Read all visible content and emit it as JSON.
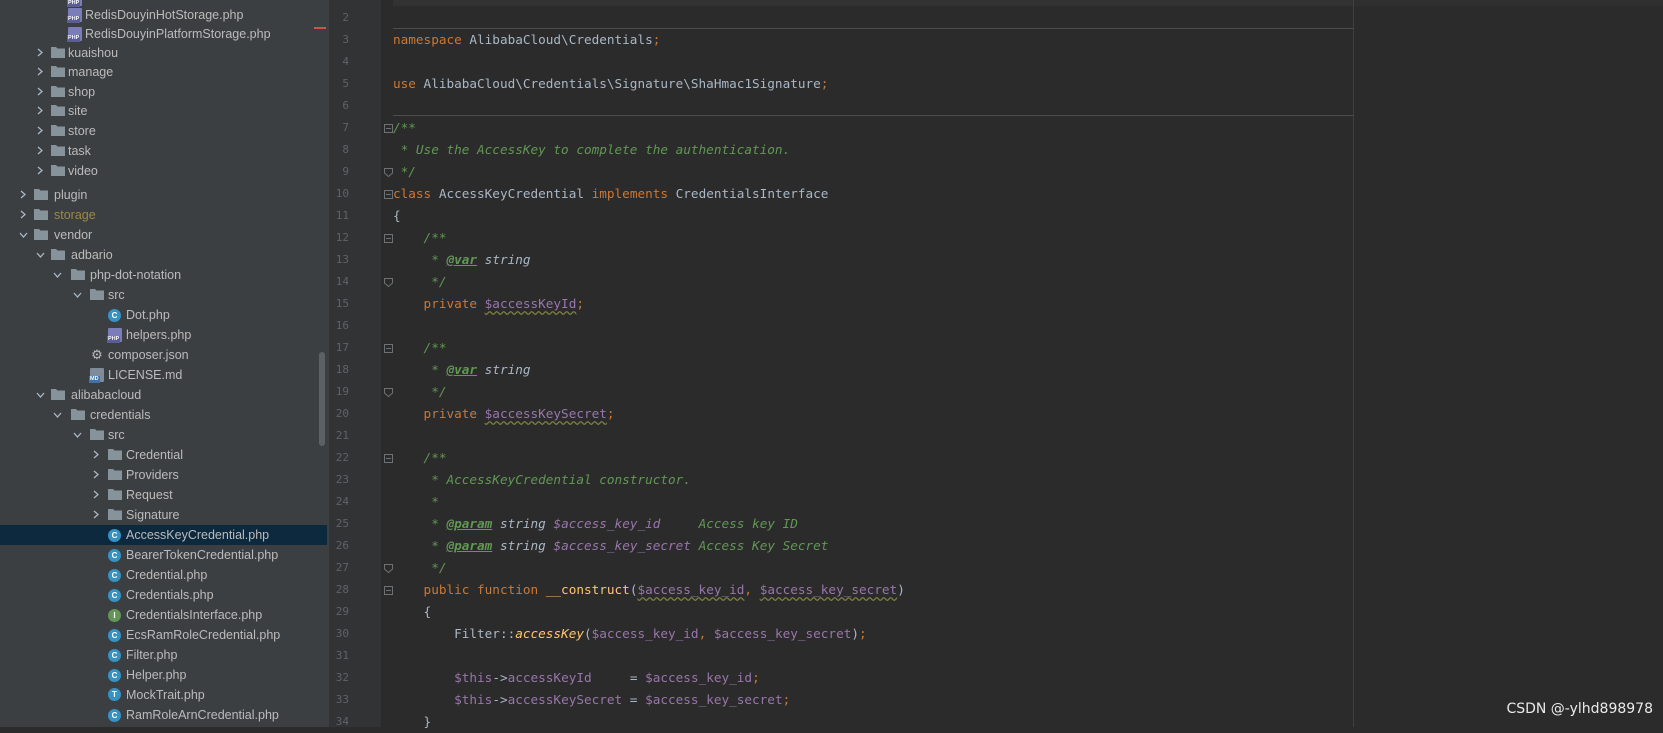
{
  "tree": [
    {
      "label": "RedisDouyinHotStorage.php",
      "icon": "php"
    },
    {
      "label": "RedisDouyinPlatformStorage.php",
      "icon": "php"
    },
    {
      "label": "kuaishou",
      "icon": "folder"
    },
    {
      "label": "manage",
      "icon": "folder"
    },
    {
      "label": "shop",
      "icon": "folder"
    },
    {
      "label": "site",
      "icon": "folder"
    },
    {
      "label": "store",
      "icon": "folder"
    },
    {
      "label": "task",
      "icon": "folder"
    },
    {
      "label": "video",
      "icon": "folder"
    },
    {
      "label": "plugin",
      "icon": "folder"
    },
    {
      "label": "storage",
      "icon": "folder"
    },
    {
      "label": "vendor",
      "icon": "folder"
    },
    {
      "label": "adbario",
      "icon": "folder"
    },
    {
      "label": "php-dot-notation",
      "icon": "folder"
    },
    {
      "label": "src",
      "icon": "folder"
    },
    {
      "label": "Dot.php",
      "icon": "class"
    },
    {
      "label": "helpers.php",
      "icon": "php"
    },
    {
      "label": "composer.json",
      "icon": "json"
    },
    {
      "label": "LICENSE.md",
      "icon": "md"
    },
    {
      "label": "alibabacloud",
      "icon": "folder"
    },
    {
      "label": "credentials",
      "icon": "folder"
    },
    {
      "label": "src",
      "icon": "folder"
    },
    {
      "label": "Credential",
      "icon": "folder"
    },
    {
      "label": "Providers",
      "icon": "folder"
    },
    {
      "label": "Request",
      "icon": "folder"
    },
    {
      "label": "Signature",
      "icon": "folder"
    },
    {
      "label": "AccessKeyCredential.php",
      "icon": "class"
    },
    {
      "label": "BearerTokenCredential.php",
      "icon": "class"
    },
    {
      "label": "Credential.php",
      "icon": "class"
    },
    {
      "label": "Credentials.php",
      "icon": "class"
    },
    {
      "label": "CredentialsInterface.php",
      "icon": "interface"
    },
    {
      "label": "EcsRamRoleCredential.php",
      "icon": "class"
    },
    {
      "label": "Filter.php",
      "icon": "class"
    },
    {
      "label": "Helper.php",
      "icon": "class"
    },
    {
      "label": "MockTrait.php",
      "icon": "trait"
    },
    {
      "label": "RamRoleArnCredential.php",
      "icon": "class"
    }
  ],
  "selected_file": "AccessKeyCredential.php",
  "line_numbers": [
    "2",
    "3",
    "4",
    "5",
    "6",
    "7",
    "8",
    "9",
    "10",
    "11",
    "12",
    "13",
    "14",
    "15",
    "16",
    "17",
    "18",
    "19",
    "20",
    "21",
    "22",
    "23",
    "24",
    "25",
    "26",
    "27",
    "28",
    "29",
    "30",
    "31",
    "32",
    "33",
    "34"
  ],
  "code": {
    "l3_kw": "namespace",
    "l3_ns": " AlibabaCloud\\Credentials",
    "l5_kw": "use",
    "l5_ns": " AlibabaCloud\\Credentials\\Signature\\ShaHmac1Signature",
    "l7": "/**",
    "l8": " * Use the AccessKey to complete the authentication.",
    "l9": " */",
    "l10_kw1": "class",
    "l10_name": " AccessKeyCredential ",
    "l10_kw2": "implements",
    "l10_iface": " CredentialsInterface",
    "l11": "{",
    "doc_open": "    /**",
    "doc_star": "     * ",
    "var_tag": "@var",
    "string_type": " string",
    "doc_close": "     */",
    "private_kw": "    private ",
    "prop1": "$accessKeyId",
    "prop2": "$accessKeySecret",
    "l23": "     * AccessKeyCredential constructor.",
    "l24": "     *",
    "param_tag": "@param",
    "p1_name": "$access_key_id",
    "p1_desc": "     Access key ID",
    "p2_name": "$access_key_secret",
    "p2_desc": " Access Key Secret",
    "l28_kw": "    public function ",
    "l28_fn": "__construct",
    "l29": "    {",
    "l30_cls": "        Filter",
    "l30_op": "::",
    "l30_fn": "accessKey",
    "this": "$this",
    "arrow": "->",
    "f1": "accessKeyId",
    "f1_pad": "     = ",
    "f2": "accessKeySecret",
    "f2_pad": " = ",
    "l34": "    }"
  },
  "watermark": "CSDN @-ylhd898978"
}
